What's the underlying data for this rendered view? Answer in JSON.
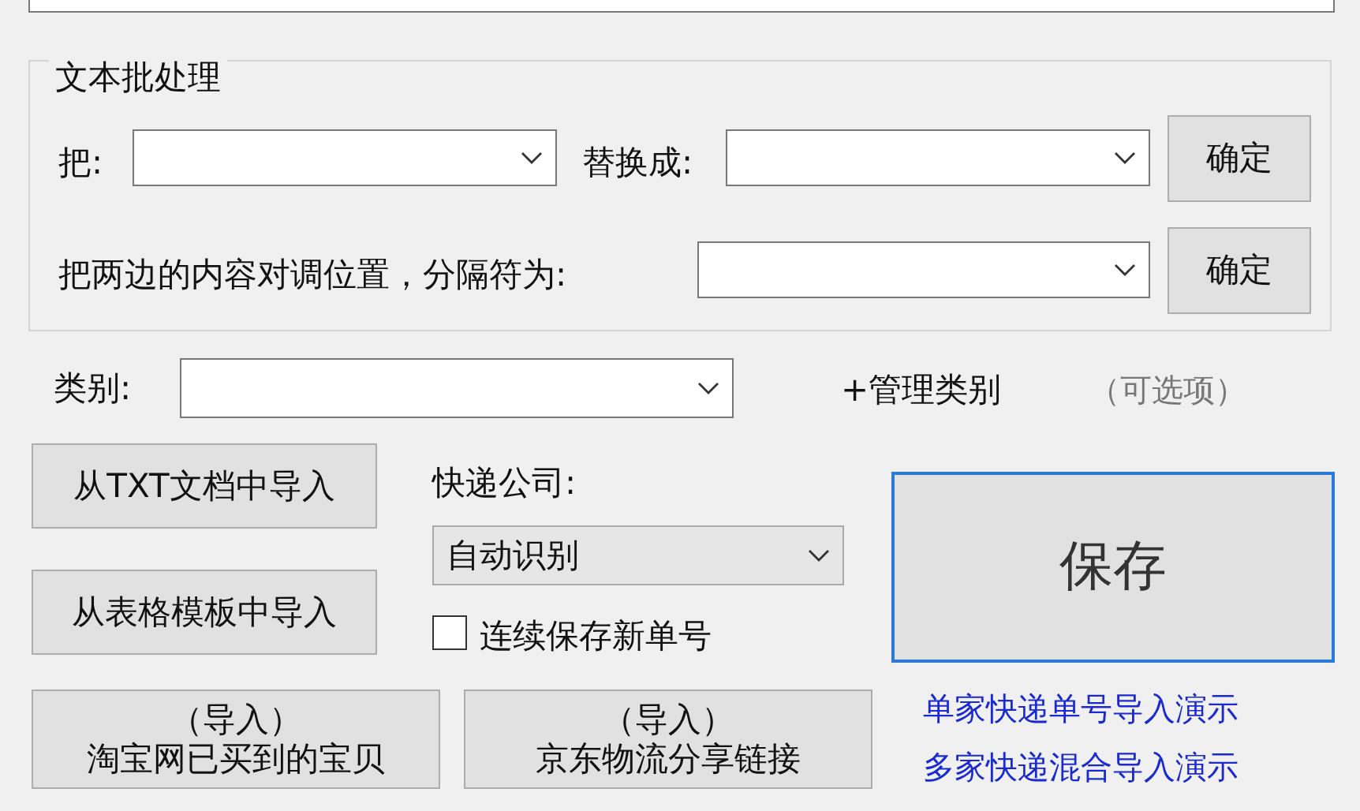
{
  "batch_group": {
    "title": "文本批处理",
    "replace_row": {
      "from_label": "把:",
      "to_label": "替换成:",
      "button": "确定"
    },
    "swap_row": {
      "label": "把两边的内容对调位置，分隔符为:",
      "button": "确定"
    }
  },
  "category": {
    "label": "类别:",
    "manage_link": "+管理类别",
    "hint": "（可选项）"
  },
  "import_buttons": [
    "从TXT文档中导入",
    "从表格模板中导入"
  ],
  "courier": {
    "label": "快递公司:",
    "value": "自动识别"
  },
  "continuous_save": {
    "label": "连续保存新单号",
    "checked": false
  },
  "save_button": "保存",
  "demo_links": [
    "单家快递单号导入演示",
    "多家快递混合导入演示"
  ],
  "bottom_buttons": [
    {
      "line1": "（导入）",
      "line2": "淘宝网已买到的宝贝"
    },
    {
      "line1": "（导入）",
      "line2": "京东物流分享链接"
    }
  ]
}
